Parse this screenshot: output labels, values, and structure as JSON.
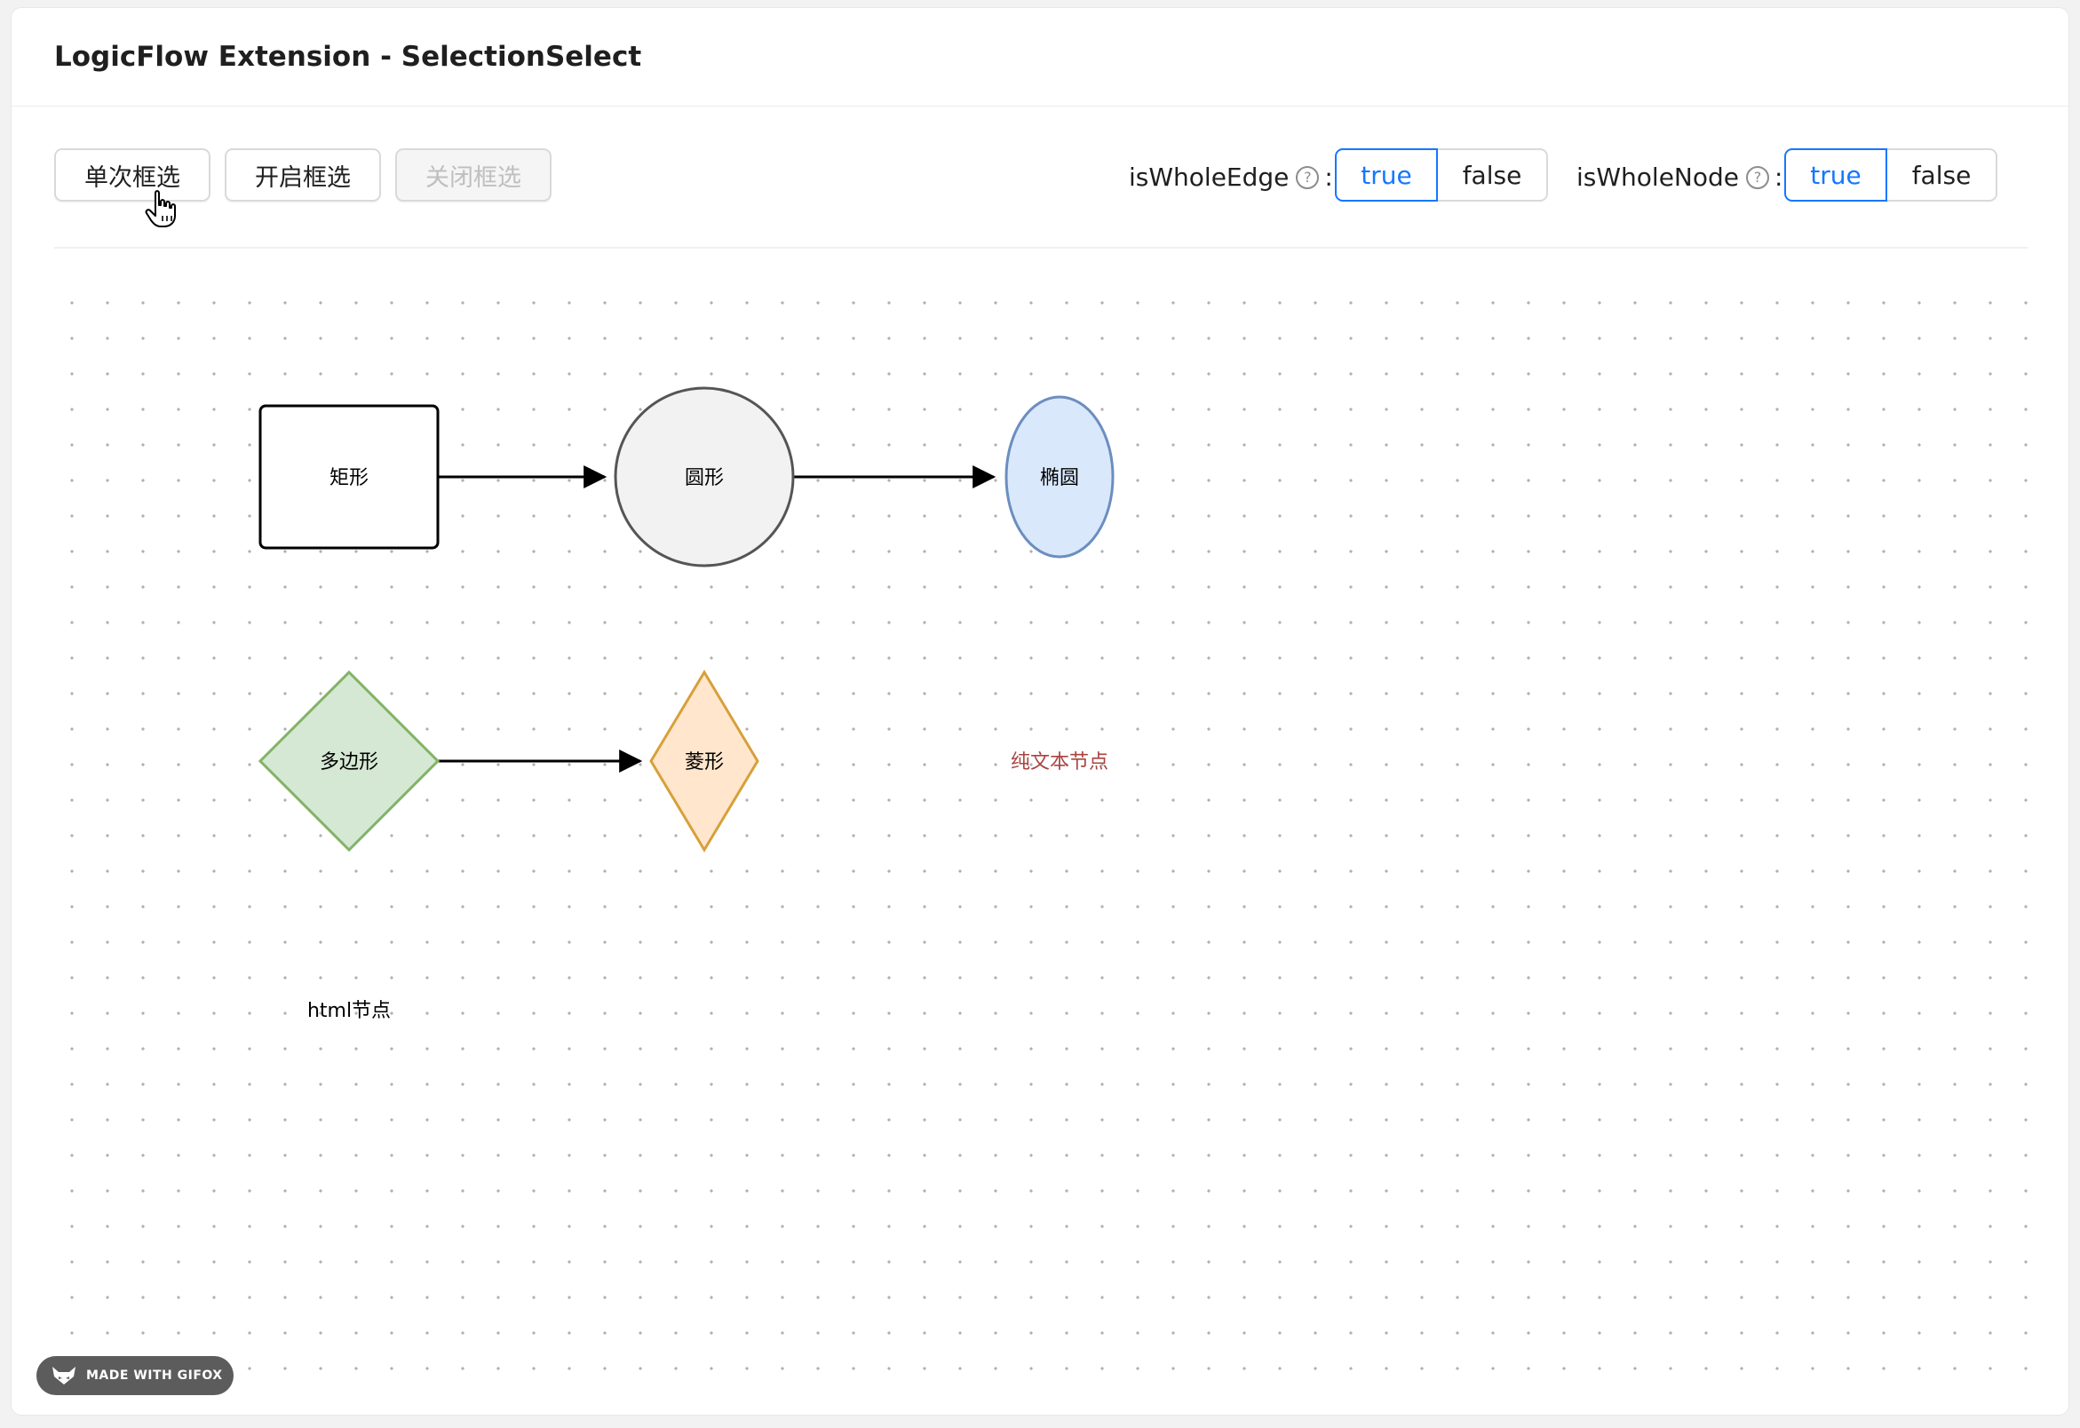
{
  "header": {
    "title": "LogicFlow Extension - SelectionSelect"
  },
  "toolbar": {
    "single_select_label": "单次框选",
    "open_select_label": "开启框选",
    "close_select_label": "关闭框选"
  },
  "options": {
    "whole_edge": {
      "label": "isWholeEdge",
      "help_glyph": "?",
      "colon": ":",
      "true_label": "true",
      "false_label": "false",
      "selected": "true"
    },
    "whole_node": {
      "label": "isWholeNode",
      "help_glyph": "?",
      "colon": ":",
      "true_label": "true",
      "false_label": "false",
      "selected": "true"
    }
  },
  "canvas": {
    "nodes": {
      "rect": "矩形",
      "circle": "圆形",
      "ellipse": "椭圆",
      "polygon": "多边形",
      "diamond": "菱形",
      "text": "纯文本节点",
      "html": "html节点"
    }
  },
  "colors": {
    "accent": "#1677ff",
    "circle_fill": "#f2f2f2",
    "ellipse_fill": "#dae8fc",
    "ellipse_stroke": "#6c8ebf",
    "polygon_fill": "#d5e8d4",
    "polygon_stroke": "#82b366",
    "diamond_fill": "#ffe6cc",
    "diamond_stroke": "#d6a03a",
    "text_node_color": "#a94442"
  },
  "badge": {
    "text": "MADE WITH GIFOX"
  }
}
